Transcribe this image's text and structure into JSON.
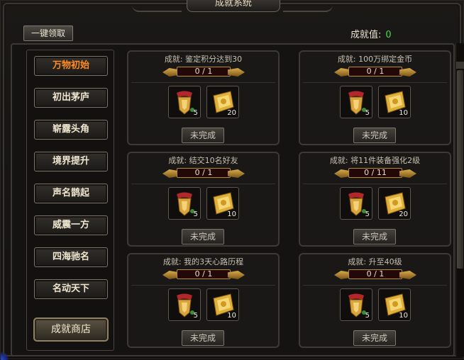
{
  "window": {
    "title": "成就系统"
  },
  "toolbar": {
    "claim_all_label": "一键领取",
    "score_label": "成就值:",
    "score_value": "0"
  },
  "sidebar": {
    "items": [
      {
        "label": "万物初始",
        "active": true
      },
      {
        "label": "初出茅庐",
        "active": false
      },
      {
        "label": "崭露头角",
        "active": false
      },
      {
        "label": "境界提升",
        "active": false
      },
      {
        "label": "声名鹊起",
        "active": false
      },
      {
        "label": "威震一方",
        "active": false
      },
      {
        "label": "四海驰名",
        "active": false
      },
      {
        "label": "名动天下",
        "active": false
      }
    ],
    "shop_label": "成就商店"
  },
  "cards": [
    {
      "title": "成就: 鉴定积分达到30",
      "progress": "0 / 1",
      "progress_fraction": 0,
      "rewards": [
        {
          "icon": "scroll-medal-icon",
          "count": "5"
        },
        {
          "icon": "gold-ingot-icon",
          "count": "20"
        }
      ],
      "status": "未完成"
    },
    {
      "title": "成就: 100万绑定金币",
      "progress": "0 / 1",
      "progress_fraction": 0,
      "rewards": [
        {
          "icon": "scroll-medal-icon",
          "count": "5"
        },
        {
          "icon": "gold-ingot-icon",
          "count": "10"
        }
      ],
      "status": "未完成"
    },
    {
      "title": "成就: 结交10名好友",
      "progress": "0 / 1",
      "progress_fraction": 0,
      "rewards": [
        {
          "icon": "scroll-medal-icon",
          "count": "5"
        },
        {
          "icon": "gold-ingot-icon",
          "count": "10"
        }
      ],
      "status": "未完成"
    },
    {
      "title": "成就: 将11件装备强化2级",
      "progress": "0 / 11",
      "progress_fraction": 0,
      "rewards": [
        {
          "icon": "scroll-medal-icon",
          "count": "5"
        },
        {
          "icon": "gold-ingot-icon",
          "count": "20"
        }
      ],
      "status": "未完成"
    },
    {
      "title": "成就: 我的3天心路历程",
      "progress": "0 / 1",
      "progress_fraction": 0,
      "rewards": [
        {
          "icon": "scroll-medal-icon",
          "count": "5"
        },
        {
          "icon": "gold-ingot-icon",
          "count": "10"
        }
      ],
      "status": "未完成"
    },
    {
      "title": "成就: 升至40级",
      "progress": "0 / 1",
      "progress_fraction": 0,
      "rewards": [
        {
          "icon": "scroll-medal-icon",
          "count": "5"
        },
        {
          "icon": "gold-ingot-icon",
          "count": "10"
        }
      ],
      "status": "未完成"
    }
  ]
}
